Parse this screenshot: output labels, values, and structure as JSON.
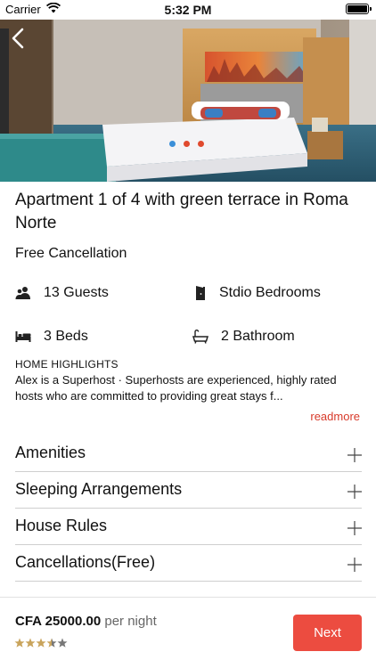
{
  "status_bar": {
    "carrier": "Carrier",
    "time": "5:32 PM"
  },
  "hero": {
    "slide_count": 3,
    "active_slide": 0,
    "dot_colors": {
      "active": "#3a8fd8",
      "inactive": "#e04a2e"
    }
  },
  "listing": {
    "title": "Apartment 1 of 4 with green terrace in Roma Norte",
    "cancellation": "Free Cancellation",
    "features": [
      {
        "icon": "guests-icon",
        "label": "13 Guests"
      },
      {
        "icon": "door-icon",
        "label": "Stdio Bedrooms"
      },
      {
        "icon": "bed-icon",
        "label": "3 Beds"
      },
      {
        "icon": "bathtub-icon",
        "label": "2 Bathroom"
      }
    ],
    "highlights_label": "HOME HIGHLIGHTS",
    "highlights_text": "Alex is a Superhost · Superhosts are experienced, highly rated hosts who are committed to providing great stays f...",
    "readmore": "readmore"
  },
  "sections": [
    {
      "label": "Amenities"
    },
    {
      "label": "Sleeping Arrangements"
    },
    {
      "label": "House Rules"
    },
    {
      "label": "Cancellations(Free)"
    }
  ],
  "footer": {
    "price": "CFA 25000.00",
    "per_night": "per night",
    "rating": 3.5,
    "next_label": "Next"
  },
  "colors": {
    "accent": "#ec4c40",
    "readmore": "#d83a2a",
    "star": "#c9a45c"
  }
}
